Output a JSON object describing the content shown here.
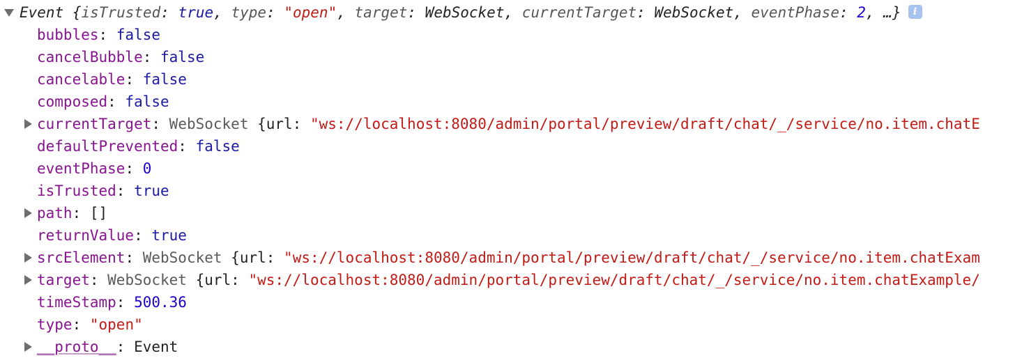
{
  "event_object": {
    "header": {
      "prefix": "Event ",
      "open_brace": "{",
      "pairs": [
        {
          "key": "isTrusted",
          "value": "true",
          "kind": "kw"
        },
        {
          "key": "type",
          "value": "\"open\"",
          "kind": "str"
        },
        {
          "key": "target",
          "value": "WebSocket",
          "kind": "plain"
        },
        {
          "key": "currentTarget",
          "value": "WebSocket",
          "kind": "plain"
        },
        {
          "key": "eventPhase",
          "value": "2",
          "kind": "num"
        }
      ],
      "sep": ", ",
      "colon": ": ",
      "ellipsis": "…}",
      "info_icon": "info-icon",
      "info_glyph": "i"
    },
    "properties": [
      {
        "key": "bubbles",
        "value": "false",
        "expandable": false
      },
      {
        "key": "cancelBubble",
        "value": "false",
        "expandable": false
      },
      {
        "key": "cancelable",
        "value": "false",
        "expandable": false
      },
      {
        "key": "composed",
        "value": "false",
        "expandable": false
      },
      {
        "key": "currentTarget",
        "class_name": "WebSocket",
        "brace": " {url: ",
        "url": "\"ws://localhost:8080/admin/portal/preview/draft/chat/_/service/no.item.chatE",
        "expandable": true
      },
      {
        "key": "defaultPrevented",
        "value": "false",
        "expandable": false
      },
      {
        "key": "eventPhase",
        "value": "0",
        "expandable": false
      },
      {
        "key": "isTrusted",
        "value": "true",
        "expandable": false
      },
      {
        "key": "path",
        "value": "[]",
        "expandable": true
      },
      {
        "key": "returnValue",
        "value": "true",
        "expandable": false
      },
      {
        "key": "srcElement",
        "class_name": "WebSocket",
        "brace": " {url: ",
        "url": "\"ws://localhost:8080/admin/portal/preview/draft/chat/_/service/no.item.chatExam",
        "expandable": true
      },
      {
        "key": "target",
        "class_name": "WebSocket",
        "brace": " {url: ",
        "url": "\"ws://localhost:8080/admin/portal/preview/draft/chat/_/service/no.item.chatExample/",
        "expandable": true
      },
      {
        "key": "timeStamp",
        "value": "500.36",
        "expandable": false
      },
      {
        "key": "type",
        "value": "\"open\"",
        "expandable": false
      },
      {
        "key": "__proto__",
        "value": "Event",
        "expandable": true
      }
    ],
    "colon": ": "
  },
  "colors": {
    "key": "#881391",
    "keyword": "#1a1aa6",
    "string": "#c41a16",
    "number": "#1c00cf",
    "class_name": "#5a5a5a",
    "info_badge": "#a6c3f0"
  }
}
